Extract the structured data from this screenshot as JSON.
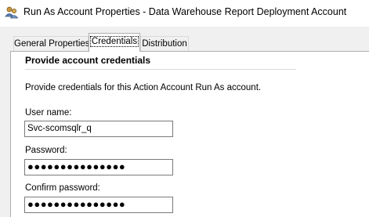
{
  "window": {
    "title": "Run As Account Properties - Data Warehouse Report Deployment Account",
    "icon": "run-as-account-icon"
  },
  "tabs": [
    {
      "label": "General Properties",
      "selected": false
    },
    {
      "label": "Credentials",
      "selected": true
    },
    {
      "label": "Distribution",
      "selected": false
    }
  ],
  "credentials": {
    "section_header": "Provide account credentials",
    "description": "Provide credentials for this Action Account Run As account.",
    "username_label": "User name:",
    "username_value": "Svc-scomsqlr_q",
    "password_label": "Password:",
    "password_value": "●●●●●●●●●●●●●●●",
    "confirm_label": "Confirm password:",
    "confirm_value": "●●●●●●●●●●●●●●●"
  }
}
